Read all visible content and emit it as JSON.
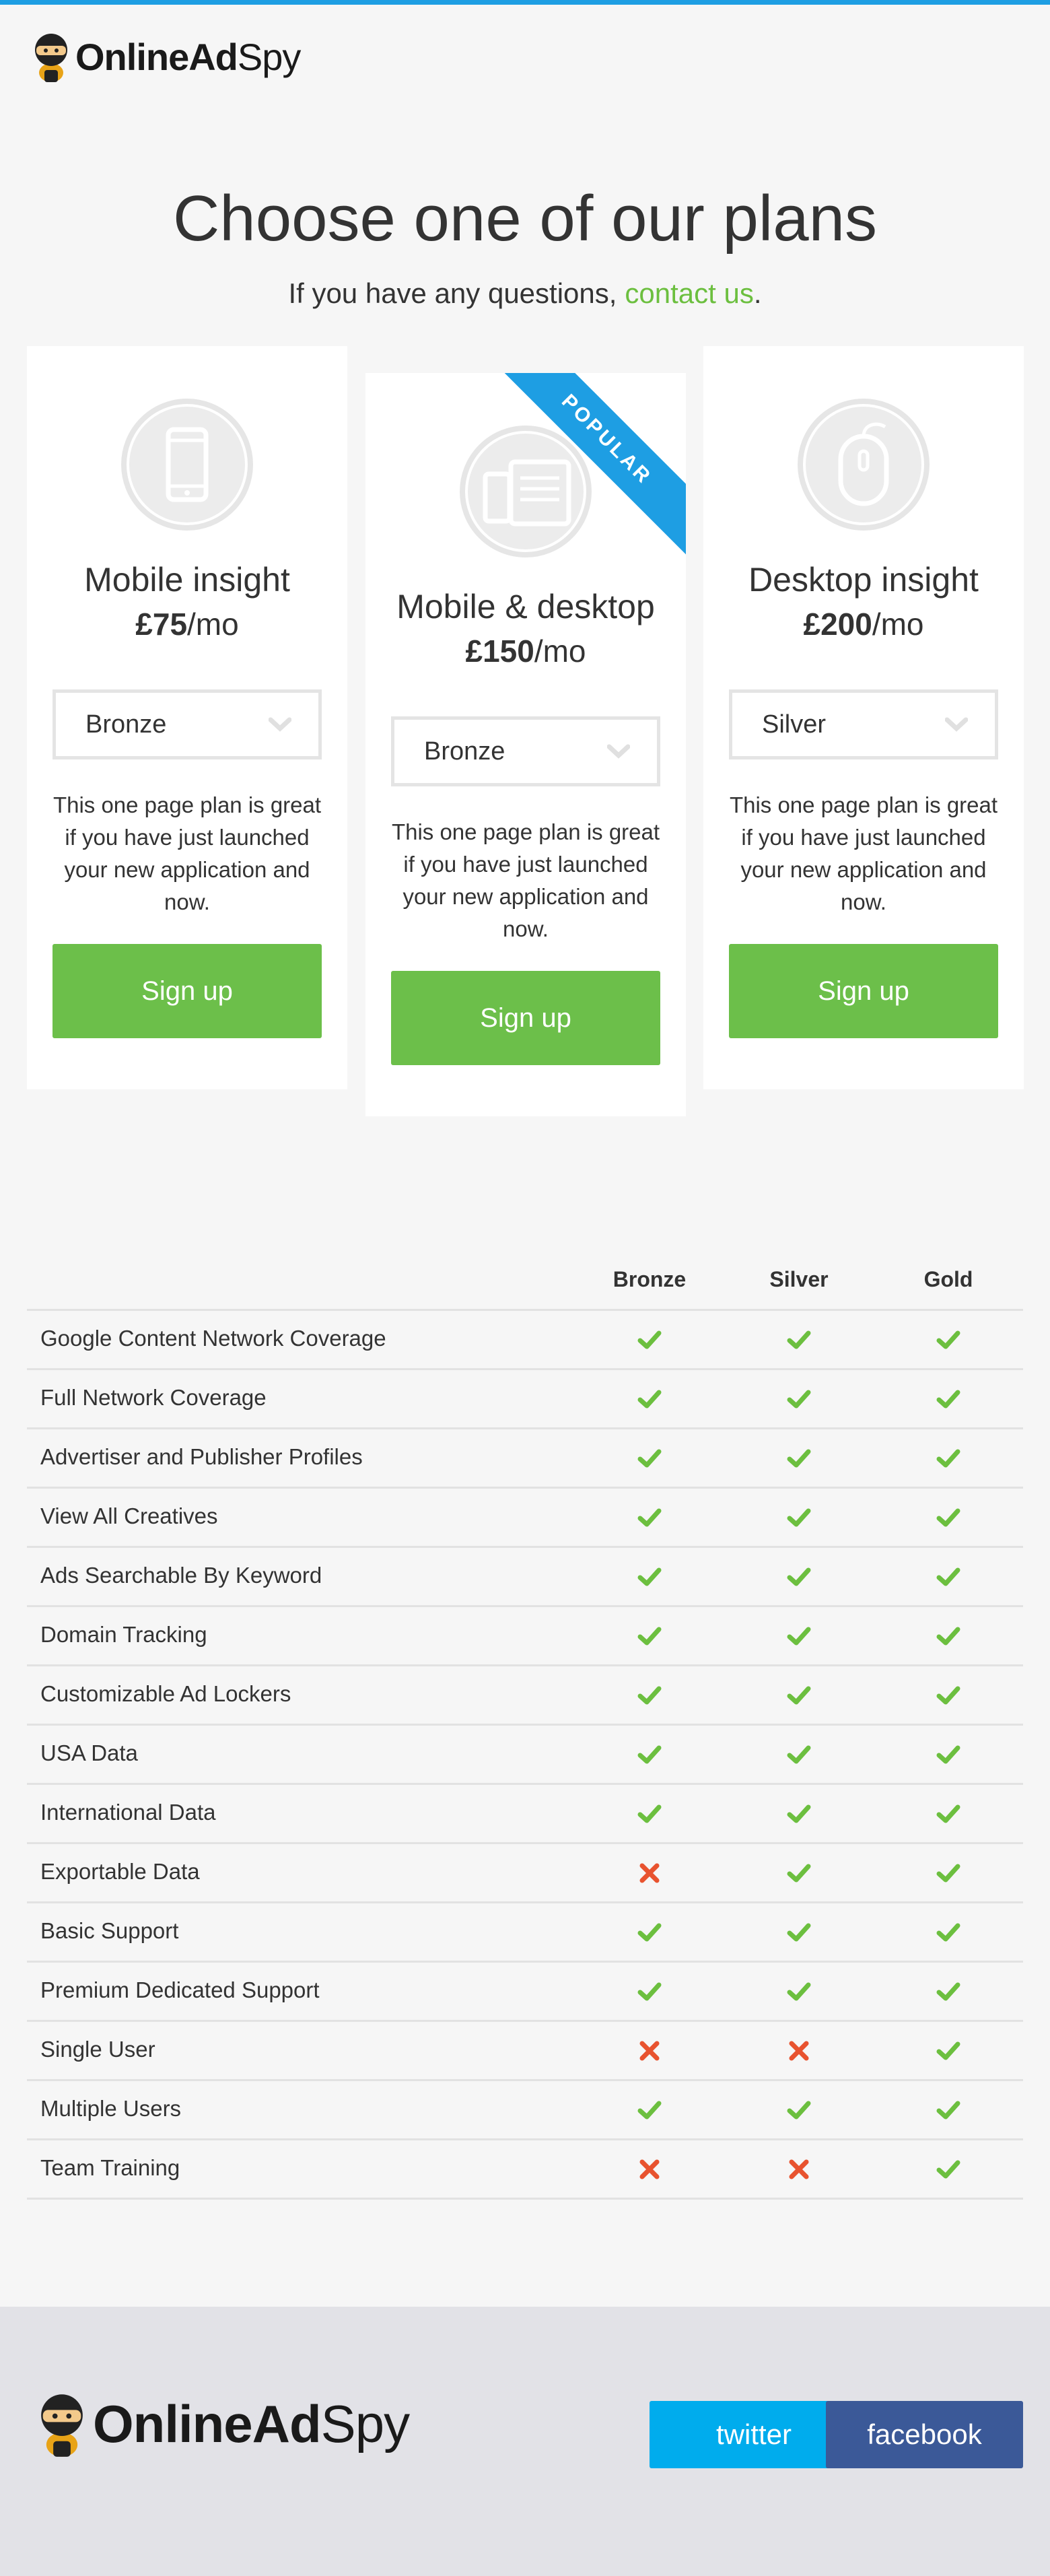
{
  "header": {
    "logo_bold": "OnlineAd",
    "logo_light": "Spy"
  },
  "hero": {
    "title": "Choose one of our plans",
    "subtitle": "If you have any questions,",
    "contact_link": "contact us",
    "period": "."
  },
  "plans": [
    {
      "icon": "mobile-phone-icon",
      "name": "Mobile insight",
      "price": "£75",
      "per": "/mo",
      "selected_tier": "Bronze",
      "description": "This one page plan is great if you have just launched your new application and now.",
      "cta": "Sign up"
    },
    {
      "icon": "mobile-desktop-icon",
      "name": "Mobile & desktop",
      "price": "£150",
      "per": "/mo",
      "selected_tier": "Bronze",
      "badge": "POPULAR",
      "description": "This one page plan is great if you have just launched your new application and now.",
      "cta": "Sign up"
    },
    {
      "icon": "mouse-icon",
      "name": "Desktop insight",
      "price": "£200",
      "per": "/mo",
      "selected_tier": "Silver",
      "description": "This one page plan is great if you have just launched your new application and now.",
      "cta": "Sign up"
    }
  ],
  "comparison": {
    "columns": [
      "Bronze",
      "Silver",
      "Gold"
    ],
    "rows": [
      {
        "feature": "Google Content Network Coverage",
        "bronze": true,
        "silver": true,
        "gold": true
      },
      {
        "feature": "Full Network Coverage",
        "bronze": true,
        "silver": true,
        "gold": true
      },
      {
        "feature": "Advertiser and Publisher Profiles",
        "bronze": true,
        "silver": true,
        "gold": true
      },
      {
        "feature": "View All Creatives",
        "bronze": true,
        "silver": true,
        "gold": true
      },
      {
        "feature": "Ads Searchable By Keyword",
        "bronze": true,
        "silver": true,
        "gold": true
      },
      {
        "feature": "Domain Tracking",
        "bronze": true,
        "silver": true,
        "gold": true
      },
      {
        "feature": "Customizable Ad Lockers",
        "bronze": true,
        "silver": true,
        "gold": true
      },
      {
        "feature": "USA Data",
        "bronze": true,
        "silver": true,
        "gold": true
      },
      {
        "feature": "International Data",
        "bronze": true,
        "silver": true,
        "gold": true
      },
      {
        "feature": "Exportable Data",
        "bronze": false,
        "silver": true,
        "gold": true
      },
      {
        "feature": "Basic Support",
        "bronze": true,
        "silver": true,
        "gold": true
      },
      {
        "feature": "Premium Dedicated Support",
        "bronze": true,
        "silver": true,
        "gold": true
      },
      {
        "feature": "Single User",
        "bronze": false,
        "silver": false,
        "gold": true
      },
      {
        "feature": "Multiple Users",
        "bronze": true,
        "silver": true,
        "gold": true
      },
      {
        "feature": "Team Training",
        "bronze": false,
        "silver": false,
        "gold": true
      }
    ]
  },
  "footer": {
    "logo_bold": "OnlineAd",
    "logo_light": "Spy",
    "twitter": "twitter",
    "facebook": "facebook"
  },
  "colors": {
    "accent_blue": "#1e9ee3",
    "green": "#6cbf4a",
    "check_green": "#6cbf3f",
    "cross_red": "#e8532f",
    "twitter": "#00aced",
    "facebook": "#3b5998"
  }
}
